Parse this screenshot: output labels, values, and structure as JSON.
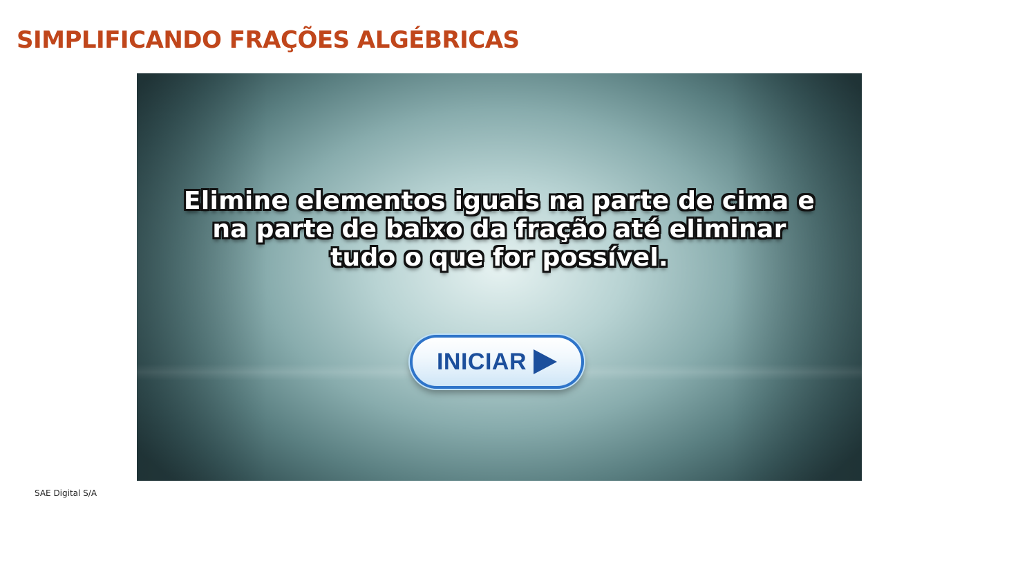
{
  "page": {
    "title": "SIMPLIFICANDO FRAÇÕES ALGÉBRICAS",
    "footer": "SAE Digital S/A"
  },
  "game": {
    "instructions": "Elimine elementos iguais na parte de cima e na parte de baixo da fração até eliminar tudo o que for possível.",
    "start_button": {
      "label": "INICIAR",
      "icon": "play-triangle-icon"
    }
  },
  "colors": {
    "title": "#c0461b",
    "button_text": "#1c4f9c",
    "button_border": "#2e74c9"
  }
}
